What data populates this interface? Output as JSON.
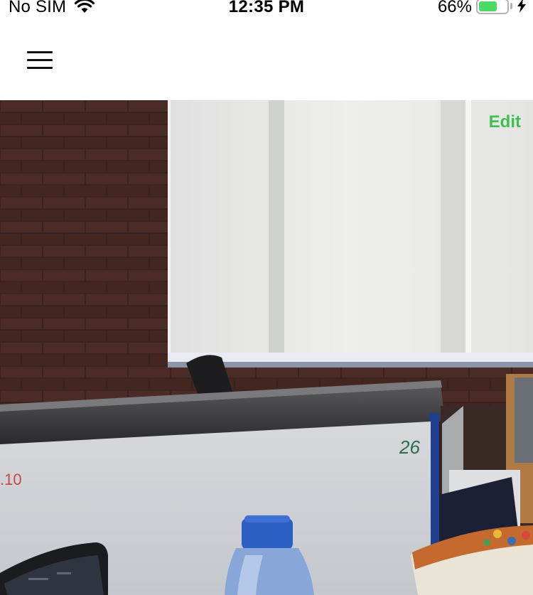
{
  "status_bar": {
    "carrier": "No SIM",
    "time": "12:35 PM",
    "battery_percent": "66%",
    "battery_level": 0.66,
    "wifi_icon": "wifi-icon",
    "charging_icon": "charging-bolt-icon"
  },
  "nav": {
    "menu_icon": "hamburger-menu-icon"
  },
  "photo": {
    "edit_label": "Edit",
    "board_number_left": ".10",
    "board_number_right": "26"
  },
  "colors": {
    "accent": "#3fbf4f",
    "battery": "#4cd964"
  }
}
